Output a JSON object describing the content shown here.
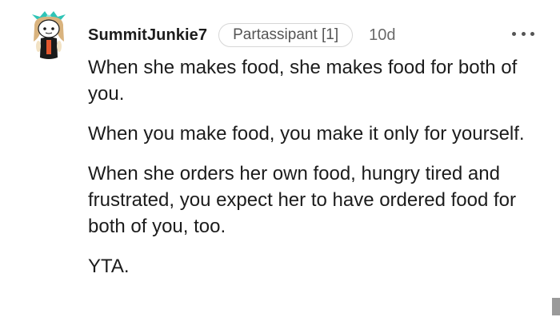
{
  "comment": {
    "author": "SummitJunkie7",
    "flair": "Partassipant [1]",
    "age": "10d",
    "paragraphs": [
      "When she makes food, she makes food for both of you.",
      "When you make food, you make it only for yourself.",
      "When she orders her own food, hungry tired and frustrated, you expect her to have ordered food for both of you, too.",
      "YTA."
    ]
  },
  "icons": {
    "avatar": "snoo-avatar-icon",
    "more": "more-options-icon"
  },
  "colors": {
    "text": "#1c1c1c",
    "muted": "#6a6a6a",
    "flair_border": "#d6d6d6",
    "avatar_hair": "#d9b37e",
    "avatar_hat": "#2ec4b6",
    "avatar_shirt": "#1a1a1a",
    "avatar_accent": "#e4572e"
  }
}
